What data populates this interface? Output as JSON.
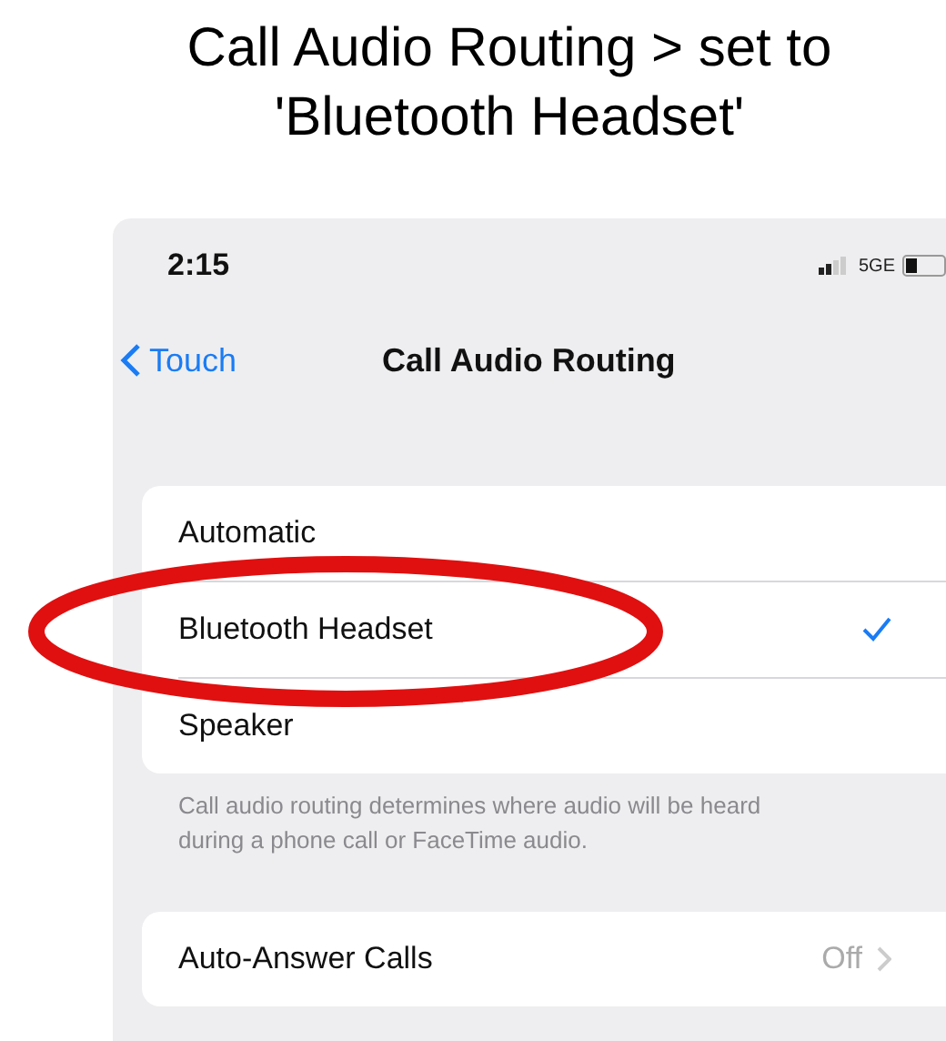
{
  "caption_lines": [
    "Call Audio Routing > set to",
    "'Bluetooth Headset'"
  ],
  "status_bar": {
    "time": "2:15",
    "network": "5GE"
  },
  "nav": {
    "back": "Touch",
    "title": "Call Audio Routing"
  },
  "options": [
    {
      "label": "Automatic",
      "selected": false
    },
    {
      "label": "Bluetooth Headset",
      "selected": true
    },
    {
      "label": "Speaker",
      "selected": false
    }
  ],
  "footer": "Call audio routing determines where audio will be heard during a phone call or FaceTime audio.",
  "annotation": {
    "kind": "ellipse",
    "color": "#e01010"
  },
  "auto_answer": {
    "label": "Auto-Answer Calls",
    "value": "Off"
  }
}
